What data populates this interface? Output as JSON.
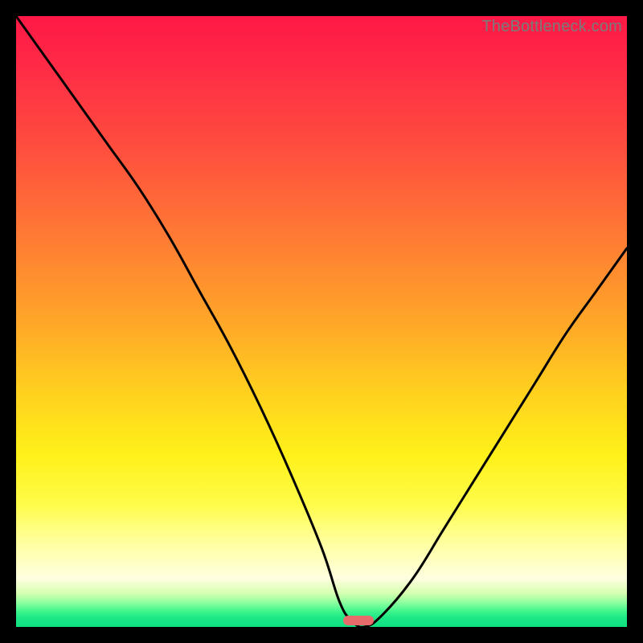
{
  "watermark": "TheBottleneck.com",
  "colors": {
    "frame": "#000000",
    "curve": "#000000",
    "optimum_marker": "#e86b6b"
  },
  "chart_data": {
    "type": "line",
    "title": "",
    "xlabel": "",
    "ylabel": "",
    "xlim": [
      0,
      100
    ],
    "ylim": [
      0,
      100
    ],
    "series": [
      {
        "name": "bottleneck-curve",
        "x": [
          0,
          5,
          10,
          15,
          20,
          25,
          30,
          35,
          40,
          45,
          50,
          53,
          55,
          57,
          60,
          65,
          70,
          75,
          80,
          85,
          90,
          95,
          100
        ],
        "values": [
          100,
          93,
          86,
          79,
          72,
          64,
          55,
          46,
          36,
          25,
          13,
          4,
          1,
          0,
          2,
          8,
          16,
          24,
          32,
          40,
          48,
          55,
          62
        ]
      }
    ],
    "optimum": {
      "x": 56,
      "width_pct": 5,
      "height_pct": 1.6
    },
    "annotations": []
  }
}
